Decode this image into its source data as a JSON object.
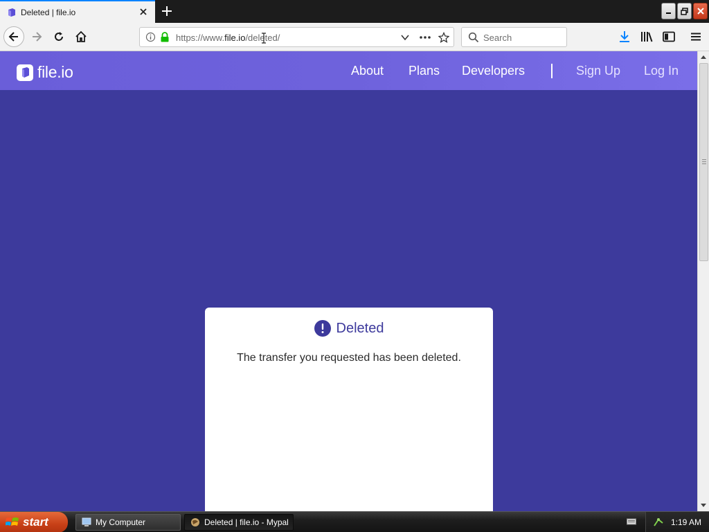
{
  "browser": {
    "tab_title": "Deleted | file.io",
    "url_prefix": "https://www.",
    "url_host": "file.io",
    "url_path": "/deleted/",
    "search_placeholder": "Search"
  },
  "site": {
    "logo_text": "file.io",
    "nav": {
      "about": "About",
      "plans": "Plans",
      "developers": "Developers",
      "signup": "Sign Up",
      "login": "Log In"
    },
    "colors": {
      "background": "#3d3a9c",
      "header": "#6e62dc",
      "card": "#ffffff"
    }
  },
  "card": {
    "title": "Deleted",
    "message": "The transfer you requested has been deleted."
  },
  "taskbar": {
    "start_label": "start",
    "items": [
      {
        "label": "My Computer"
      },
      {
        "label": "Deleted | file.io - Mypal"
      }
    ],
    "clock": "1:19 AM"
  }
}
